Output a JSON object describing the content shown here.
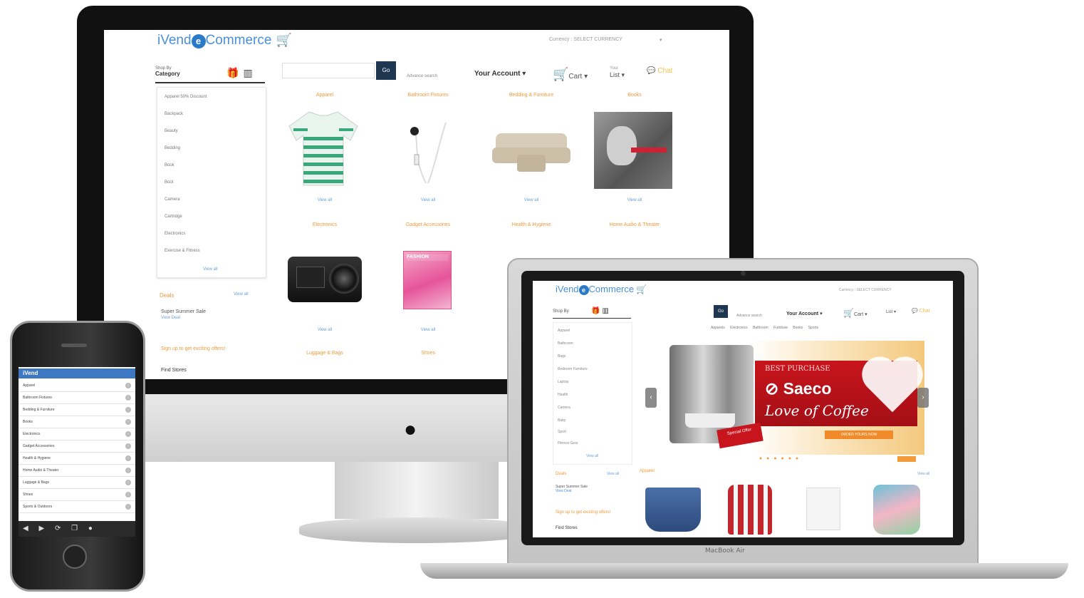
{
  "brand": {
    "logo_prefix": "iVend",
    "logo_mark": "e",
    "logo_suffix": "Commerce"
  },
  "desktop": {
    "language": "Currency : SELECT CURRENCY",
    "shop_by": "Shop By",
    "shop_by_value": "Category",
    "go_label": "Go",
    "advanced_search": "Advance search",
    "account": "Your Account",
    "cart": "Cart",
    "list_small": "Your",
    "list": "List",
    "chat": "Chat",
    "sidebar_items": [
      "Apparel 50% Discount",
      "Backpack",
      "Beauty",
      "Bedding",
      "Book",
      "Boot",
      "Camera",
      "Cartridge",
      "Electronics",
      "Exercise & Fitness"
    ],
    "sidebar_view_all": "View all",
    "deals_title": "Deals",
    "deals_view_all": "View all",
    "deal_name": "Super Summer Sale",
    "deal_link": "View Deal",
    "signup": "Sign up to get exciting offers!",
    "find_store": "Find Stores",
    "categories_row1": [
      "Apparel",
      "Bathroom Fixtures",
      "Bedding & Furniture",
      "Books"
    ],
    "categories_row2": [
      "Electronics",
      "Gadget Accessories",
      "Health & Hygiene",
      "Home Audio & Theater"
    ],
    "categories_row3": [
      "Luggage & Bags",
      "Shoes"
    ],
    "view_all": "View all",
    "magazine_head": "FASHION"
  },
  "laptop": {
    "language": "Currency : SELECT CURRENCY",
    "shop_by": "Shop By",
    "go_label": "Go",
    "advanced_search": "Advance search",
    "account": "Your Account",
    "cart": "Cart",
    "list": "List",
    "chat": "Chat",
    "nav": "Apparels Electronics Bathroom Furniture Books Sports",
    "sidebar_items": [
      "Apparel",
      "Bathroom",
      "Bags",
      "Bedroom Furniture",
      "Laptop",
      "Health",
      "Camera",
      "Baby",
      "Sport",
      "Fitness Gear"
    ],
    "sidebar_view_all": "View all",
    "deals_title": "Deals",
    "deals_view_all": "View all",
    "deal_name": "Super Summer Sale",
    "deal_link": "View Deal",
    "signup": "Sign up to get exciting offers!",
    "find_store": "Find Stores",
    "banner": {
      "kicker": "BEST PURCHASE",
      "brand": "Saeco",
      "tagline": "Love of Coffee",
      "cta": "ORDER YOURS NOW",
      "sticker": "Special Offer"
    },
    "slider_dots": "● ● ● ● ● ●",
    "apparel_title": "Apparel",
    "apparel_view_all": "View all",
    "model": "MacBook Air"
  },
  "phone": {
    "header": "iVend",
    "rows": [
      "Apparel",
      "Bathroom Fixtures",
      "Bedding & Furniture",
      "Books",
      "Electronics",
      "Gadget Accessories",
      "Health & Hygiene",
      "Home Audio & Theater",
      "Luggage & Bags",
      "Shoes",
      "Sports & Outdoors"
    ],
    "toolbar": "◀ ▶ ⟳ ❐ ●"
  }
}
